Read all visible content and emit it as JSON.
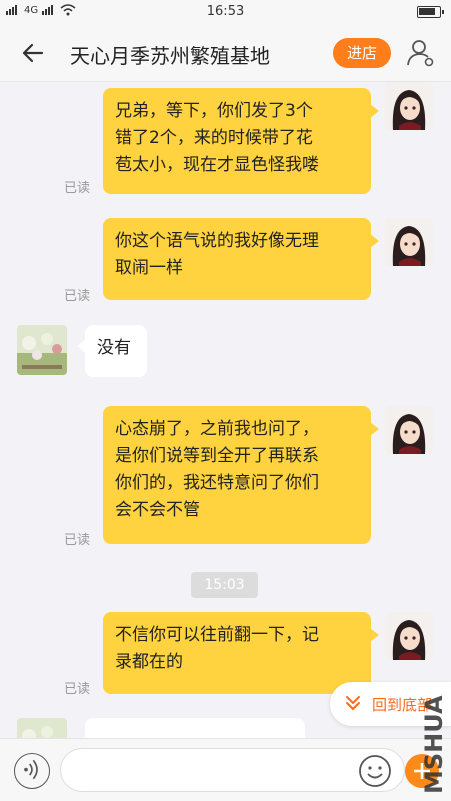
{
  "status_bar": {
    "signal_left": "4G",
    "time": "16:53",
    "battery_level": 0.85
  },
  "header": {
    "back_icon": "arrow-left-icon",
    "title": "天心月季苏州繁殖基地",
    "store_button": "进店",
    "user_icon": "user-settings-icon"
  },
  "messages": [
    {
      "side": "right",
      "text_lines": [
        "兄弟，等下，你们发了3个",
        "错了2个，来的时候带了花",
        "苞太小，现在才显色怪我喽"
      ],
      "read": "已读"
    },
    {
      "side": "right",
      "text_lines": [
        "你这个语气说的我好像无理",
        "取闹一样"
      ],
      "read": "已读"
    },
    {
      "side": "left",
      "text_lines": [
        "没有"
      ]
    },
    {
      "side": "right",
      "text_lines": [
        "心态崩了，之前我也问了，",
        "是你们说等到全开了再联系",
        "你们的，我还特意问了你们",
        "会不会不管"
      ],
      "read": "已读"
    },
    {
      "side": "right",
      "text_lines": [
        "不信你可以往前翻一下，记",
        "录都在的"
      ],
      "read": "已读"
    }
  ],
  "time_separator": "15:03",
  "back_to_bottom": "回到底部",
  "input_bar": {
    "voice_icon": "voice-icon",
    "emoji_icon": "emoji-icon",
    "plus_icon": "plus-icon"
  },
  "watermark": "MSHUA",
  "colors": {
    "accent": "#ff7d1a",
    "bubble_self": "#ffd23f",
    "bubble_other": "#ffffff",
    "background": "#f2f2f7"
  }
}
